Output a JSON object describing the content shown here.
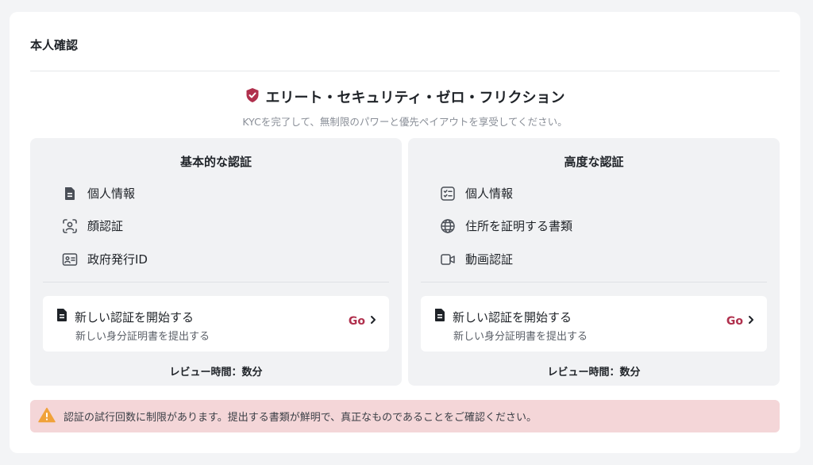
{
  "page": {
    "title": "本人確認"
  },
  "hero": {
    "title": "エリート・セキュリティ・ゼロ・フリクション",
    "subtitle": "KYCを完了して、無制限のパワーと優先ペイアウトを享受してください。",
    "icon": "shield-check-icon"
  },
  "panels": [
    {
      "title": "基本的な認証",
      "requirements": [
        {
          "label": "個人情報",
          "icon": "document-icon"
        },
        {
          "label": "顔認証",
          "icon": "face-scan-icon"
        },
        {
          "label": "政府発行ID",
          "icon": "id-card-icon"
        }
      ],
      "start": {
        "title": "新しい認証を開始する",
        "subtitle": "新しい身分証明書を提出する",
        "go": "Go"
      },
      "review": "レビュー時間：数分"
    },
    {
      "title": "高度な認証",
      "requirements": [
        {
          "label": "個人情報",
          "icon": "checklist-icon"
        },
        {
          "label": "住所を証明する書類",
          "icon": "globe-icon"
        },
        {
          "label": "動画認証",
          "icon": "video-icon"
        }
      ],
      "start": {
        "title": "新しい認証を開始する",
        "subtitle": "新しい身分証明書を提出する",
        "go": "Go"
      },
      "review": "レビュー時間：数分"
    }
  ],
  "warning": {
    "text": "認証の試行回数に制限があります。提出する書類が鮮明で、真正なものであることをご確認ください。",
    "icon": "warning-icon"
  },
  "colors": {
    "accent": "#b0304d",
    "warning_bg": "#f4d6d8",
    "warning_icon": "#f0a23a",
    "panel_bg": "#f1f2f4"
  }
}
